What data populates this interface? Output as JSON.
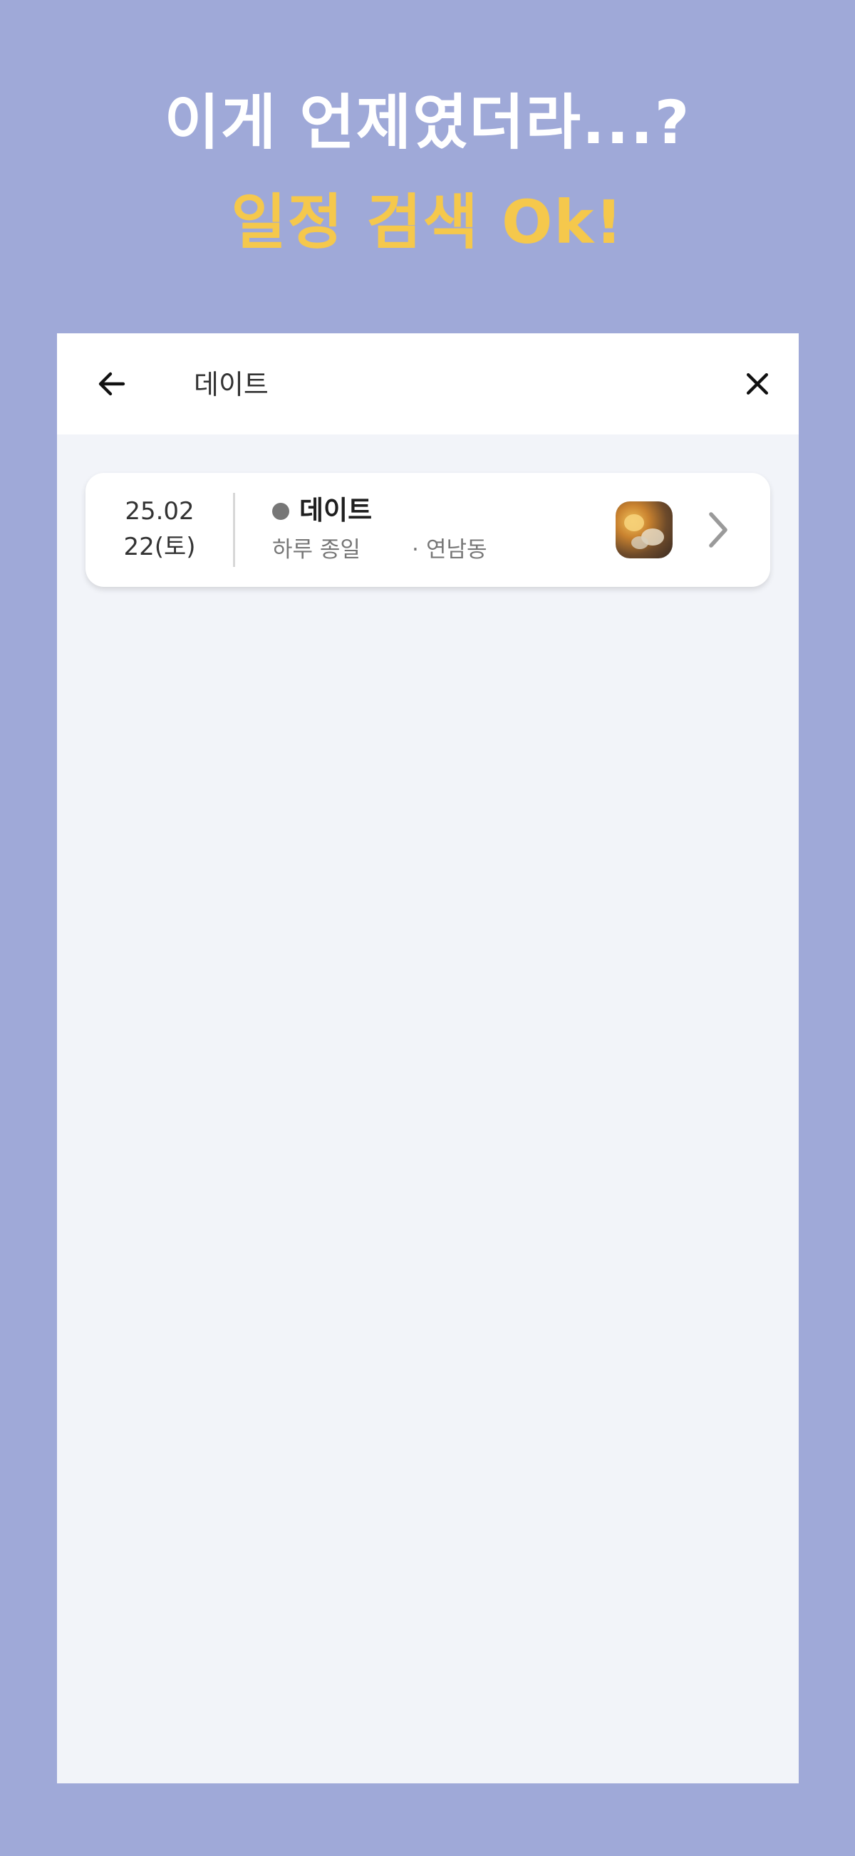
{
  "promo": {
    "headline": "이게 언제였더라...?",
    "subheadline": "일정 검색 Ok!"
  },
  "colors": {
    "background": "#9fa9d8",
    "headline": "#ffffff",
    "subheadline": "#f5c84c",
    "screen_background": "#f2f4f9",
    "card": "#ffffff",
    "status_dot": "#777777"
  },
  "search": {
    "query": "데이트",
    "back_icon": "arrow-left-icon",
    "close_icon": "close-icon"
  },
  "results": [
    {
      "date_line1": "25.02",
      "date_line2": "22(토)",
      "title": "데이트",
      "time": "하루 종일",
      "separator": "·",
      "location": "연남동",
      "thumbnail": "photo-thumbnail",
      "chevron_icon": "chevron-right-icon"
    }
  ]
}
